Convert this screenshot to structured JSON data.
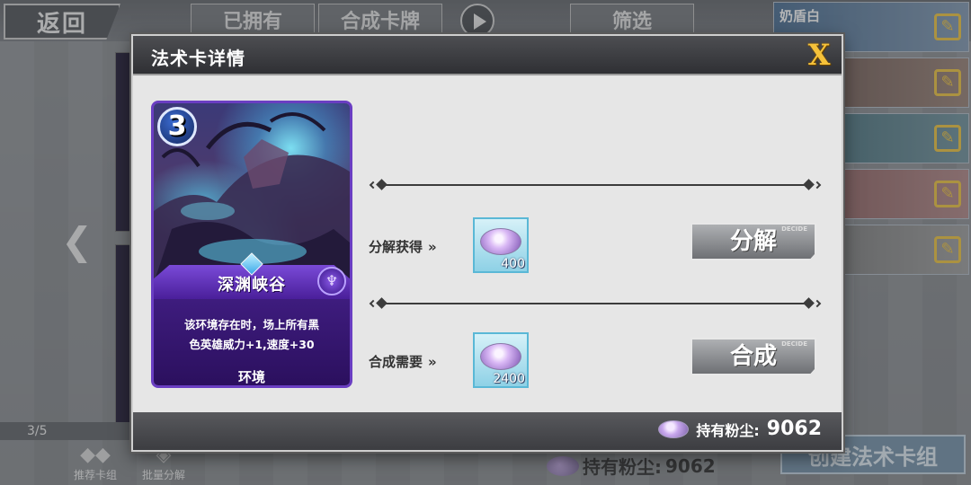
{
  "background": {
    "back_label": "返回",
    "tabs": [
      "已拥有",
      "合成卡牌",
      "筛选"
    ],
    "deck_list": [
      {
        "name": "奶盾白"
      },
      {
        "name": ""
      },
      {
        "name": ""
      },
      {
        "name": ""
      },
      {
        "name": ""
      }
    ],
    "page_indicator": "3/5",
    "bottom_buttons": [
      "推荐卡组",
      "批量分解"
    ],
    "dust_label": "持有粉尘:",
    "dust_value": "9062",
    "create_deck_label": "创建法术卡组"
  },
  "modal": {
    "title": "法术卡详情",
    "close_symbol": "X",
    "card": {
      "cost": "3",
      "name": "深渊峡谷",
      "description_line1": "该环境存在时，场上所有黑",
      "description_line2": "色英雄威力+1,速度+30",
      "type": "环境",
      "faction_icon": "trident-icon"
    },
    "disenchant": {
      "label": "分解获得",
      "chevrons": "»",
      "amount": "400",
      "button_label": "分解",
      "button_tag": "DECIDE"
    },
    "craft": {
      "label": "合成需要",
      "chevrons": "»",
      "amount": "2400",
      "button_label": "合成",
      "button_tag": "DECIDE"
    },
    "footer": {
      "dust_label": "持有粉尘:",
      "dust_value": "9062"
    }
  },
  "colors": {
    "modal_header": "#3a3b3f",
    "close_accent": "#f6c23a",
    "card_border": "#6a3ec2",
    "dust_tile": "#8ed1e6"
  }
}
